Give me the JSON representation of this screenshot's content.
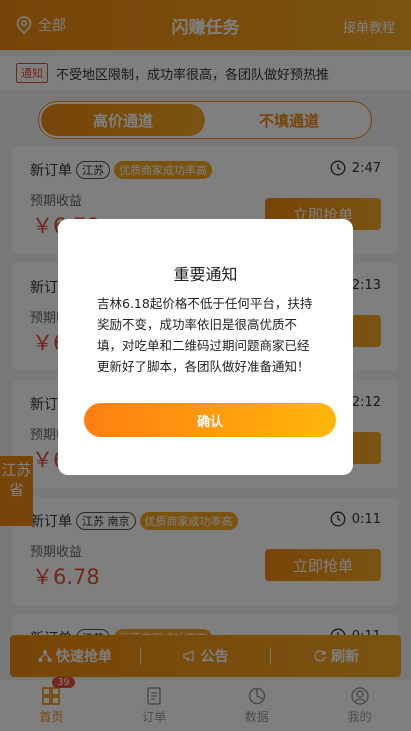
{
  "header": {
    "location": "全部",
    "title": "闪赚任务",
    "tutorial": "接单教程"
  },
  "notice": {
    "tag": "通知",
    "text": "不受地区限制，成功率很高，各团队做好预热推"
  },
  "tabs": [
    {
      "label": "高价通道",
      "active": true
    },
    {
      "label": "不填通道",
      "active": false
    }
  ],
  "orders": [
    {
      "title": "新订单",
      "province": "江苏",
      "badge": "优质商家成功率高",
      "time": "2:47",
      "income_label": "预期收益",
      "amount": "￥6.78",
      "button": "立即抢单"
    },
    {
      "title": "新订单",
      "province": "",
      "badge": "",
      "time": "2:13",
      "income_label": "预期收益",
      "amount": "￥6",
      "button": "立即抢单"
    },
    {
      "title": "新订单",
      "province": "",
      "badge": "",
      "time": "2:12",
      "income_label": "预期收益",
      "amount": "￥6",
      "button": "立即抢单"
    },
    {
      "title": "新订单",
      "province": "江苏 南京",
      "badge": "优质商家成功率高",
      "time": "0:11",
      "income_label": "预期收益",
      "amount": "￥6.78",
      "button": "立即抢单"
    },
    {
      "title": "新订单",
      "province": "江苏",
      "badge": "优质商家成功率高",
      "time": "0:11",
      "income_label": "",
      "amount": "",
      "button": ""
    }
  ],
  "province_float": "江苏省",
  "actions": {
    "quick": "快速抢单",
    "notice": "公告",
    "refresh": "刷新"
  },
  "tabbar": [
    {
      "label": "首页",
      "badge": "39",
      "active": true
    },
    {
      "label": "订单",
      "active": false
    },
    {
      "label": "数据",
      "active": false
    },
    {
      "label": "我的",
      "active": false
    }
  ],
  "modal": {
    "title": "重要通知",
    "body": "吉林6.18起价格不低于任何平台，扶持奖励不变，成功率依旧是很高优质不填，对吃单和二维码过期问题商家已经更新好了脚本，各团队做好准备通知！",
    "confirm": "确认"
  },
  "colors": {
    "accent": "#ef8a12",
    "accent_light": "#f5a623",
    "price": "#e74c3c"
  }
}
